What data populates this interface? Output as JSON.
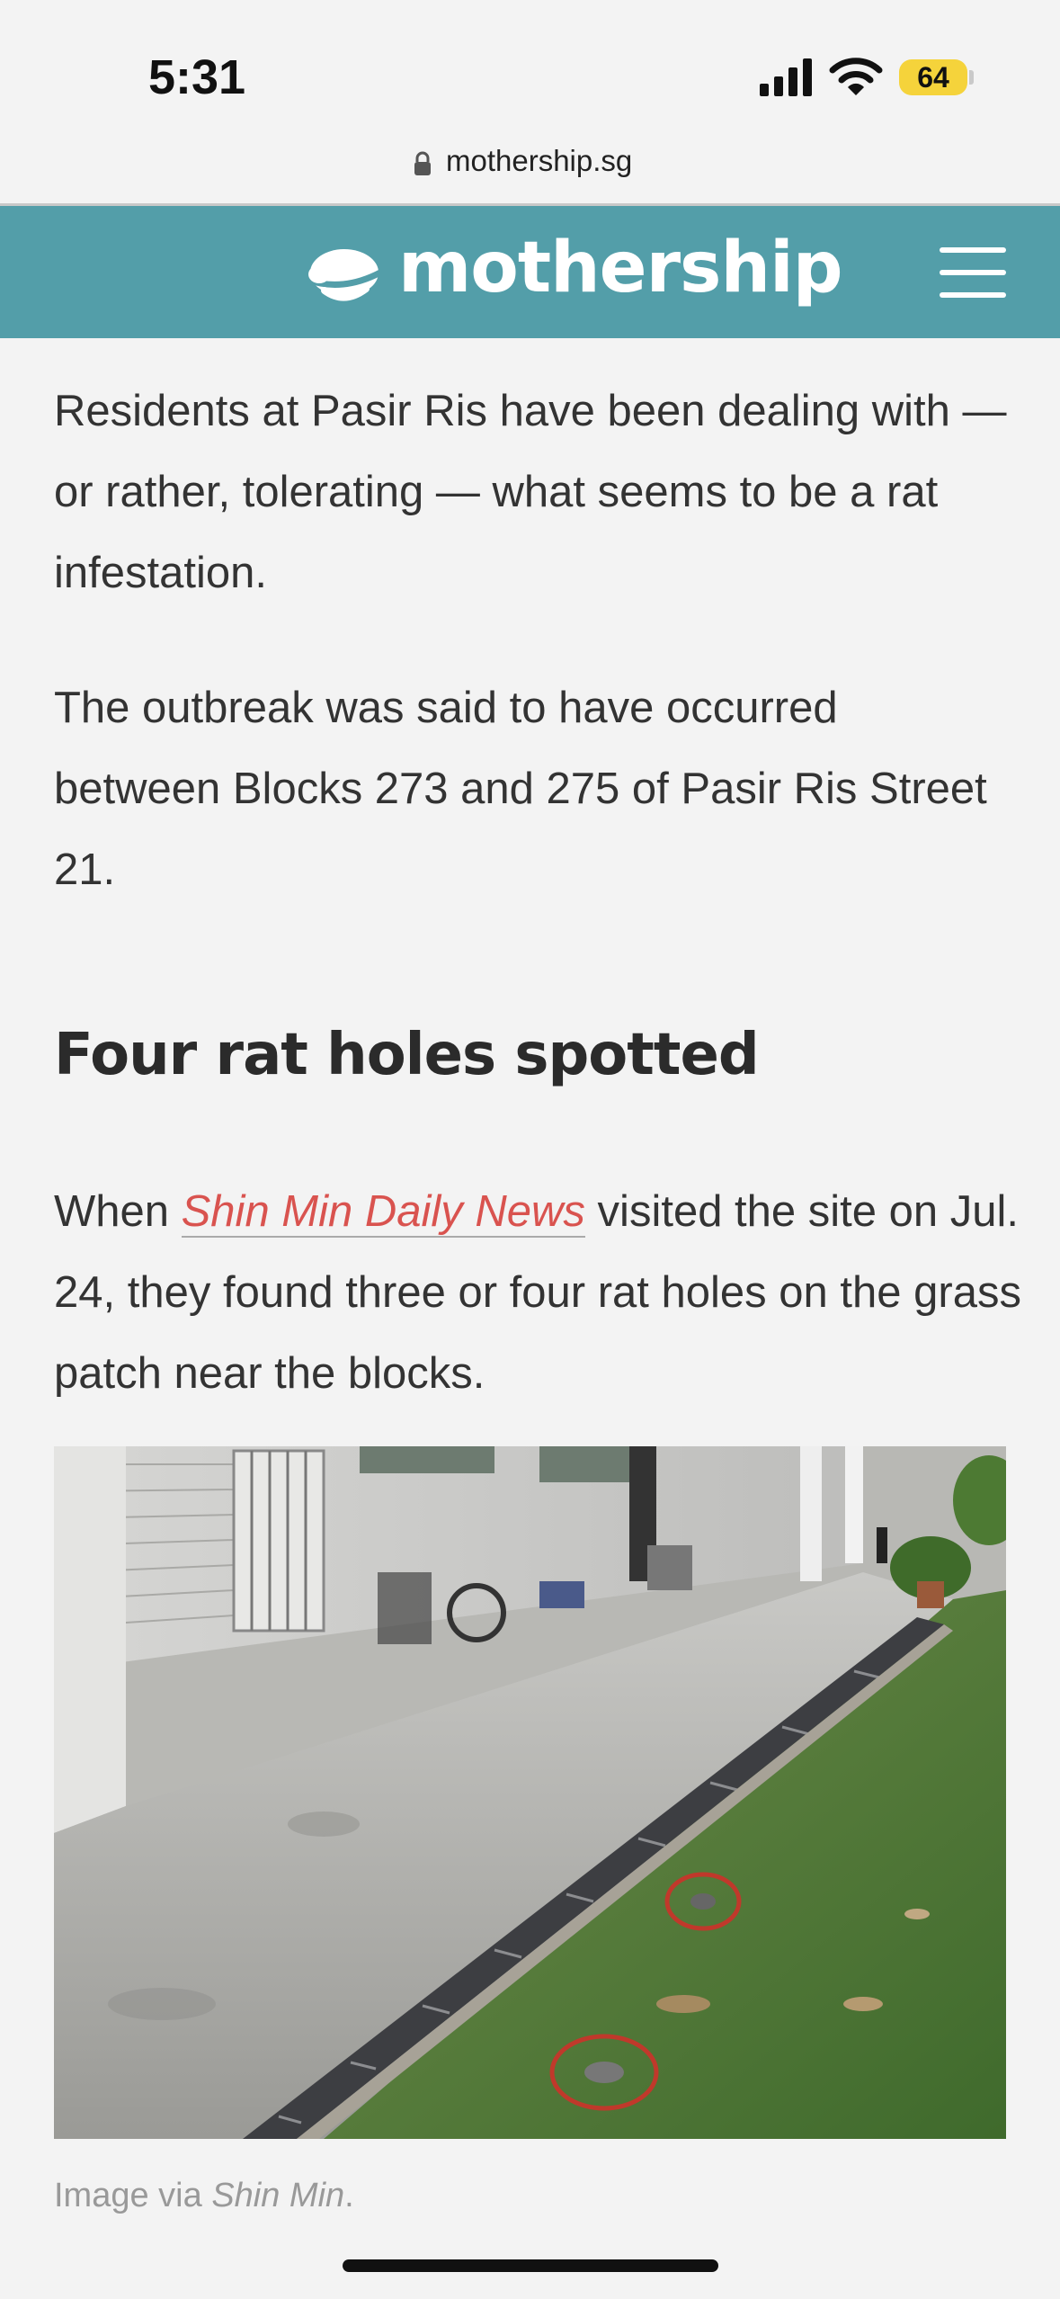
{
  "status_bar": {
    "time": "5:31",
    "battery": "64"
  },
  "browser": {
    "url": "mothership.sg"
  },
  "header": {
    "logo_text": "mothership",
    "brand_color": "#539ea9"
  },
  "article": {
    "paragraph_1": "Residents at Pasir Ris have been dealing with — or rather, tolerating — what seems to be a rat infestation.",
    "paragraph_2": "The outbreak was said to have occurred between Blocks 273 and 275 of Pasir Ris Street 21.",
    "heading": "Four rat holes spotted",
    "paragraph_3_before": "When ",
    "paragraph_3_link": "Shin Min Daily News",
    "paragraph_3_after": " visited the site on Jul. 24, they found three or four rat holes on the grass patch near the blocks.",
    "caption_prefix": "Image via ",
    "caption_source": "Shin Min",
    "caption_suffix": "."
  }
}
